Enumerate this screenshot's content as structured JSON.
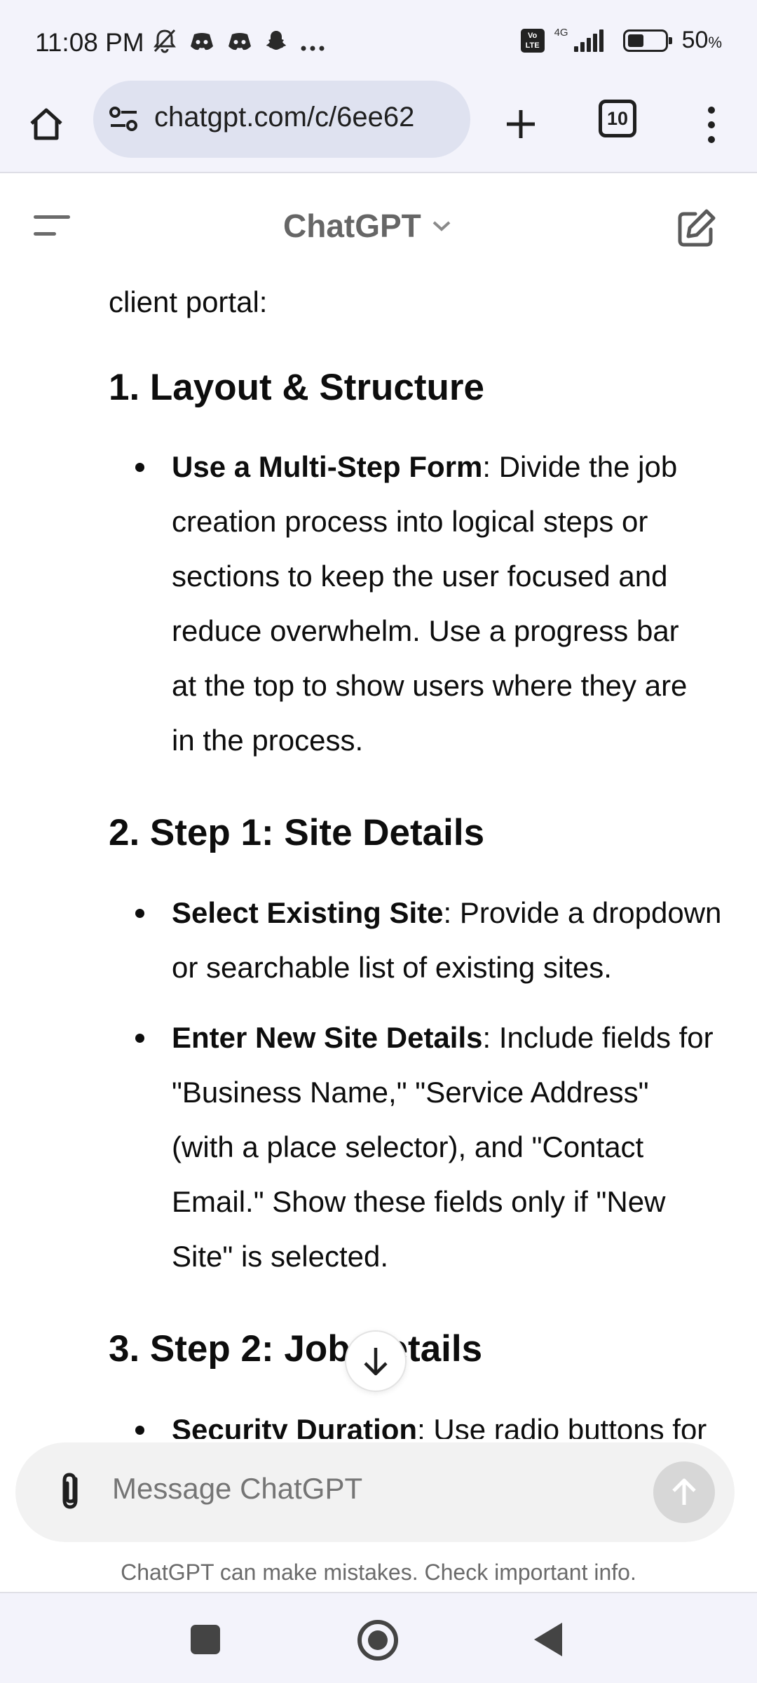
{
  "status_bar": {
    "time": "11:08 PM",
    "left_icons": [
      "bell-off-icon",
      "discord-icon",
      "discord-icon",
      "snapchat-icon",
      "more-icon"
    ],
    "network_badge": "Vo LTE",
    "network_type": "4G",
    "battery": "50",
    "battery_unit": "%"
  },
  "browser": {
    "url": "chatgpt.com/c/6ee62",
    "tab_count": "10"
  },
  "chat_header": {
    "title": "ChatGPT"
  },
  "message": {
    "lead": "client portal:",
    "sections": [
      {
        "heading": "1. Layout & Structure",
        "bullets": [
          {
            "bold": "Use a Multi-Step Form",
            "lines": [
              ": Divide the job",
              "creation process into logical steps or",
              "sections to keep the user focused and",
              "reduce overwhelm. Use a progress bar",
              "at the top to show users where they are",
              "in the process."
            ]
          }
        ]
      },
      {
        "heading": "2. Step 1: Site Details",
        "bullets": [
          {
            "bold": "Select Existing Site",
            "lines": [
              ": Provide a dropdown",
              "or searchable list of existing sites."
            ]
          },
          {
            "bold": "Enter New Site Details",
            "lines": [
              ": Include fields for",
              "\"Business Name,\" \"Service Address\"",
              "(with a place selector), and \"Contact",
              "Email.\" Show these fields only if \"New",
              "Site\" is selected."
            ]
          }
        ]
      },
      {
        "heading": "3. Step 2: Job Details",
        "bullets": [
          {
            "bold": "Security Duration",
            "lines": [
              ": Use radio buttons for"
            ]
          }
        ]
      }
    ]
  },
  "composer": {
    "placeholder": "Message ChatGPT"
  },
  "disclaimer": "ChatGPT can make mistakes. Check important info."
}
